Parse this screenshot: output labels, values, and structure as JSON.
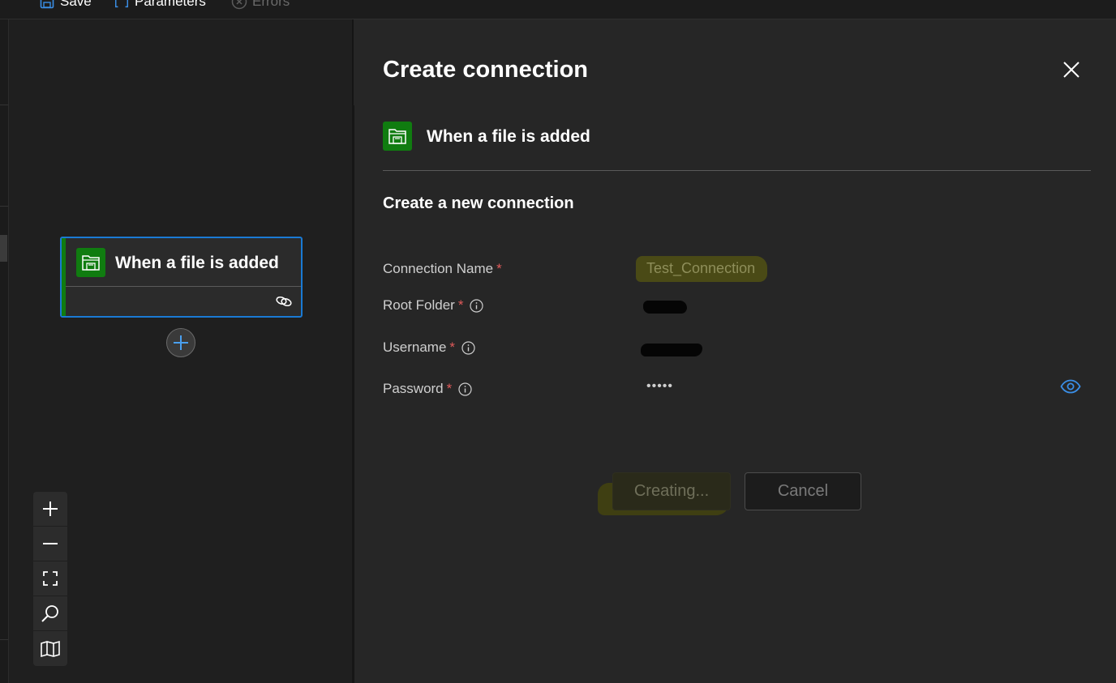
{
  "toolbar": {
    "save_label": "Save",
    "parameters_label": "Parameters",
    "errors_label": "Errors"
  },
  "canvas": {
    "node": {
      "title": "When a file is added",
      "icon": "file-system-icon",
      "accent_color": "#107c10",
      "border_color": "#1a7ad4"
    },
    "zoom_controls": [
      "zoom-in-icon",
      "zoom-out-icon",
      "fit-view-icon",
      "search-icon",
      "minimap-icon"
    ]
  },
  "panel": {
    "title": "Create connection",
    "connector": {
      "title": "When a file is added",
      "icon": "file-system-icon"
    },
    "section_title": "Create a new connection",
    "fields": [
      {
        "label": "Connection Name",
        "required_mark": "*",
        "value": "Test_Connection",
        "has_info": false
      },
      {
        "label": "Root Folder",
        "required_mark": "*",
        "value": "",
        "has_info": true
      },
      {
        "label": "Username",
        "required_mark": "*",
        "value": "",
        "has_info": true
      },
      {
        "label": "Password",
        "required_mark": "*",
        "value": "•••••",
        "has_info": true
      }
    ],
    "buttons": {
      "create_label": "Creating...",
      "cancel_label": "Cancel"
    }
  },
  "colors": {
    "accent_blue": "#1a7ad4",
    "brand_green": "#107c10",
    "required_red": "#e05a5a",
    "highlight_yellow": "#4a4a16"
  }
}
